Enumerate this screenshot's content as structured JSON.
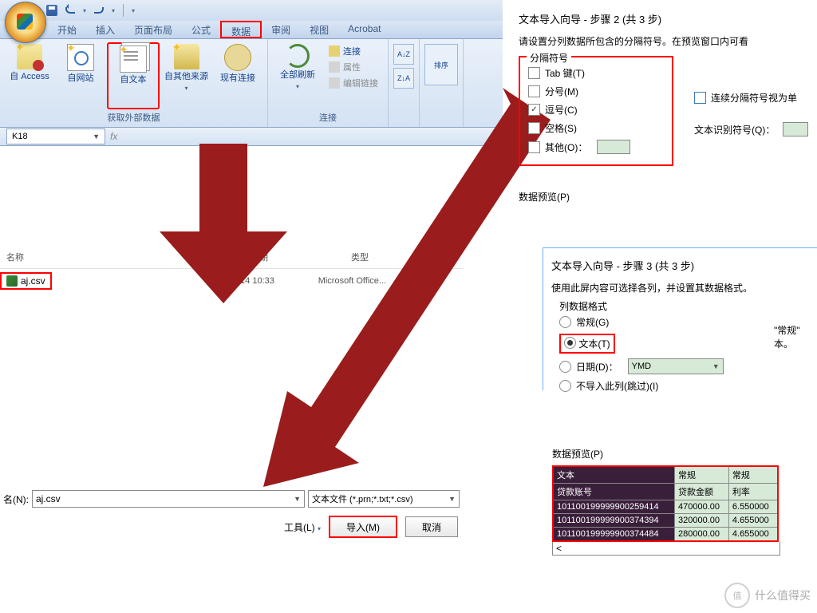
{
  "excel": {
    "qat": {
      "save": "save",
      "undo": "undo",
      "redo": "redo"
    },
    "tabs": [
      "开始",
      "插入",
      "页面布局",
      "公式",
      "数据",
      "审阅",
      "视图",
      "Acrobat"
    ],
    "active_tab_index": 4,
    "groups": {
      "external": {
        "label": "获取外部数据",
        "buttons": [
          {
            "label": "自 Access",
            "icon": "db"
          },
          {
            "label": "自网站",
            "icon": "web"
          },
          {
            "label": "自文本",
            "icon": "txt",
            "hi": true
          },
          {
            "label": "自其他来源",
            "icon": "src"
          },
          {
            "label": "现有连接",
            "icon": "conn"
          }
        ]
      },
      "connections": {
        "label": "连接",
        "refresh": "全部刷新",
        "items": [
          {
            "label": "连接",
            "en": true
          },
          {
            "label": "属性",
            "en": false
          },
          {
            "label": "编辑链接",
            "en": false
          }
        ]
      },
      "sort": {
        "az": "A↓Z",
        "za": "Z↓A",
        "label": "排序"
      }
    },
    "namebox": "K18"
  },
  "browser": {
    "cols": {
      "name": "名称",
      "date": "日期",
      "type": "类型"
    },
    "file": {
      "name": "aj.csv",
      "date": "0/3/14 10:33",
      "type": "Microsoft Office..."
    },
    "filename_label": "名(N):",
    "filename": "aj.csv",
    "filter": "文本文件 (*.prn;*.txt;*.csv)",
    "tools": "工具(L)",
    "import_btn": "导入(M)",
    "cancel_btn": "取消"
  },
  "wizard2": {
    "title": "文本导入向导 - 步骤 2 (共 3 步)",
    "sub": "请设置分列数据所包含的分隔符号。在预览窗口内可看",
    "legend": "分隔符号",
    "opts": [
      {
        "label": "Tab 键(T)",
        "chk": false
      },
      {
        "label": "分号(M)",
        "chk": false
      },
      {
        "label": "逗号(C)",
        "chk": true
      },
      {
        "label": "空格(S)",
        "chk": false
      },
      {
        "label": "其他(O)：",
        "chk": false,
        "input": true
      }
    ],
    "consec": "连续分隔符号视为单",
    "qualifier": "文本识别符号(Q)：",
    "qval": "\"",
    "preview_label": "数据预览(P)"
  },
  "wizard3": {
    "title": "文本导入向导 - 步骤 3 (共 3 步)",
    "sub": "使用此屏内容可选择各列，并设置其数据格式。",
    "legend": "列数据格式",
    "opts": [
      {
        "label": "常规(G)",
        "on": false
      },
      {
        "label": "文本(T)",
        "on": true,
        "hi": true
      },
      {
        "label": "日期(D)：",
        "on": false,
        "sel": "YMD"
      },
      {
        "label": "不导入此列(跳过)(I)",
        "on": false
      }
    ],
    "note1": "\"常规\"",
    "note2": "本。",
    "preview_label": "数据预览(P)",
    "headers": [
      "文本",
      "常规",
      "常规"
    ],
    "cols": [
      "贷款账号",
      "贷款金额",
      "利率"
    ],
    "rows": [
      [
        "101100199999900259414",
        "470000.00",
        "6.550000"
      ],
      [
        "101100199999900374394",
        "320000.00",
        "4.655000"
      ],
      [
        "101100199999900374484",
        "280000.00",
        "4.655000"
      ]
    ]
  },
  "watermark": "什么值得买"
}
